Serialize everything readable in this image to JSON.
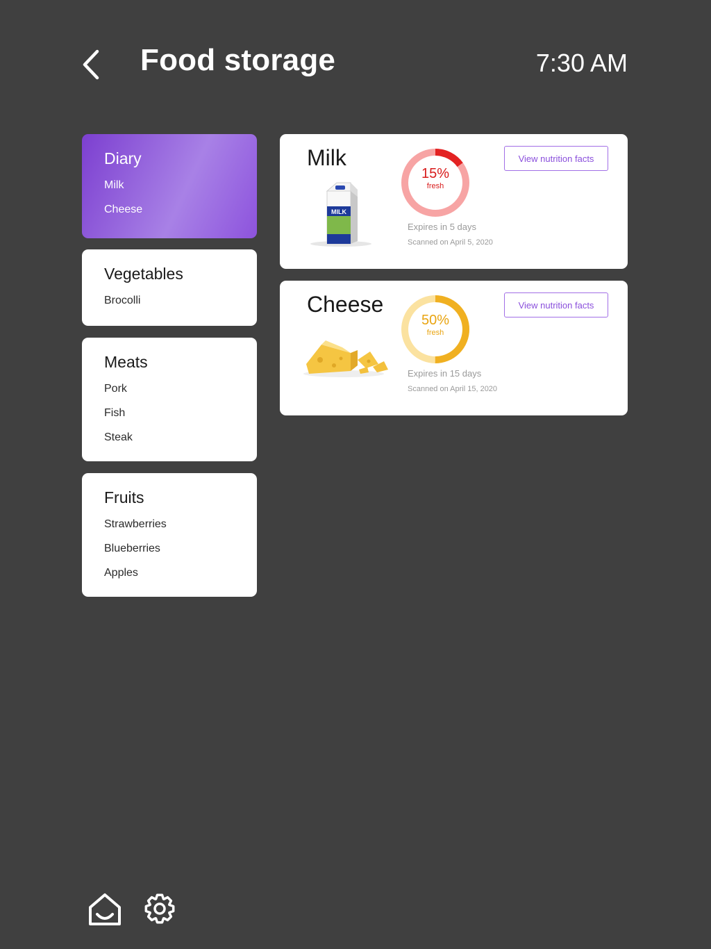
{
  "header": {
    "title": "Food storage",
    "time": "7:30 AM"
  },
  "categories": [
    {
      "title": "Diary",
      "items": [
        "Milk",
        "Cheese"
      ]
    },
    {
      "title": "Vegetables",
      "items": [
        "Brocolli"
      ]
    },
    {
      "title": "Meats",
      "items": [
        "Pork",
        "Fish",
        "Steak"
      ]
    },
    {
      "title": "Fruits",
      "items": [
        "Strawberries",
        "Blueberries",
        "Apples"
      ]
    }
  ],
  "foods": [
    {
      "name": "Milk",
      "freshness_pct": 15,
      "percent_label": "15%",
      "fresh_label": "fresh",
      "expires": "Expires in 5 days",
      "scanned": "Scanned on April 5, 2020",
      "button": "View nutrition facts",
      "ring_color": "#e32222",
      "ring_bg": "#f7a4a4",
      "text_color": "#d81b1b"
    },
    {
      "name": "Cheese",
      "freshness_pct": 50,
      "percent_label": "50%",
      "fresh_label": "fresh",
      "expires": "Expires in 15 days",
      "scanned": "Scanned on April 15, 2020",
      "button": "View nutrition facts",
      "ring_color": "#f0b021",
      "ring_bg": "#fbe2a0",
      "text_color": "#e9a410"
    }
  ],
  "colors": {
    "background": "#404040",
    "accent": "#8a4fdc",
    "card": "#ffffff"
  },
  "icons": {
    "back": "chevron-left-icon",
    "home": "home-icon",
    "settings": "gear-icon"
  }
}
